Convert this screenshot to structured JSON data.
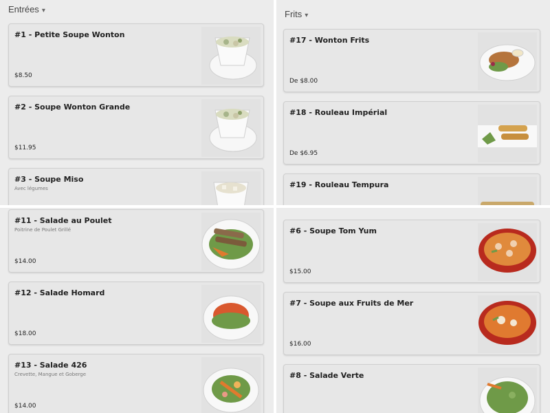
{
  "panels": {
    "top_left": {
      "section_title": "Entrées",
      "chevron": "chevron-down-icon",
      "items": [
        {
          "name": "#1 - Petite Soupe Wonton",
          "desc": "",
          "price": "$8.50",
          "photo": "wonton-soup-bowl"
        },
        {
          "name": "#2 - Soupe Wonton Grande",
          "desc": "",
          "price": "$11.95",
          "photo": "wonton-soup-bowl"
        },
        {
          "name": "#3 - Soupe Miso",
          "desc": "Avec légumes",
          "price": "",
          "photo": "miso-soup-bowl"
        }
      ]
    },
    "top_right": {
      "section_title": "Frits",
      "chevron": "chevron-down-icon",
      "items": [
        {
          "name": "#17 - Wonton Frits",
          "desc": "",
          "price": "De $8.00",
          "photo": "fried-wonton-plate"
        },
        {
          "name": "#18 - Rouleau Impérial",
          "desc": "",
          "price": "De $6.95",
          "photo": "spring-roll-plate"
        },
        {
          "name": "#19 - Rouleau Tempura",
          "desc": "",
          "price": "",
          "photo": "tempura-roll-plate"
        }
      ]
    },
    "bottom_left": {
      "items": [
        {
          "name": "#11 - Salade au Poulet",
          "desc": "Poitrine de Poulet Grillé",
          "price": "$14.00",
          "photo": "chicken-salad-plate"
        },
        {
          "name": "#12 - Salade Homard",
          "desc": "",
          "price": "$18.00",
          "photo": "lobster-salad-plate"
        },
        {
          "name": "#13 - Salade 426",
          "desc": "Crevette, Mangue et Goberge",
          "price": "$14.00",
          "photo": "shrimp-mango-salad-plate"
        }
      ]
    },
    "bottom_right": {
      "items": [
        {
          "name": "#6 - Soupe Tom Yum",
          "desc": "",
          "price": "$15.00",
          "photo": "tom-yum-bowl"
        },
        {
          "name": "#7 - Soupe aux Fruits de Mer",
          "desc": "",
          "price": "$16.00",
          "photo": "seafood-soup-bowl"
        },
        {
          "name": "#8 - Salade Verte",
          "desc": "",
          "price": "",
          "photo": "green-salad-plate"
        }
      ]
    }
  },
  "colors": {
    "background": "#ececec",
    "card": "#e7e7e7",
    "divider": "#ffffff"
  }
}
